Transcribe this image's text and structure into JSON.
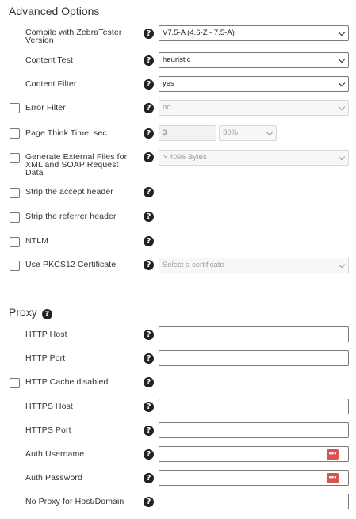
{
  "advanced": {
    "title": "Advanced Options",
    "compile": {
      "label": "Compile with ZebraTester Version",
      "value": "V7.5-A (4.6-Z - 7.5-A)"
    },
    "content_test": {
      "label": "Content Test",
      "value": "heuristic"
    },
    "content_filter": {
      "label": "Content Filter",
      "value": "yes"
    },
    "error_filter": {
      "label": "Error Filter",
      "value": "no"
    },
    "think_time": {
      "label": "Page Think Time, sec",
      "value": "3",
      "percent": "30%"
    },
    "external_files": {
      "label": "Generate External Files for XML and SOAP Request Data",
      "value": "> 4096 Bytes"
    },
    "strip_accept": {
      "label": "Strip the accept header"
    },
    "strip_referrer": {
      "label": "Strip the referrer header"
    },
    "ntlm": {
      "label": "NTLM"
    },
    "pkcs12": {
      "label": "Use PKCS12 Certificate",
      "value": "Select a certificate"
    }
  },
  "proxy": {
    "title": "Proxy",
    "http_host": {
      "label": "HTTP Host",
      "value": ""
    },
    "http_port": {
      "label": "HTTP Port",
      "value": ""
    },
    "http_cache": {
      "label": "HTTP Cache disabled"
    },
    "https_host": {
      "label": "HTTPS Host",
      "value": ""
    },
    "https_port": {
      "label": "HTTPS Port",
      "value": ""
    },
    "auth_username": {
      "label": "Auth Username",
      "value": ""
    },
    "auth_password": {
      "label": "Auth Password",
      "value": ""
    },
    "no_proxy": {
      "label": "No Proxy for Host/Domain",
      "value": ""
    }
  },
  "icons": {
    "help": "question-circle-icon",
    "password_manager": "password-key-icon",
    "dropdown": "chevron-down-icon"
  },
  "colors": {
    "password_key": "#d9534f"
  }
}
